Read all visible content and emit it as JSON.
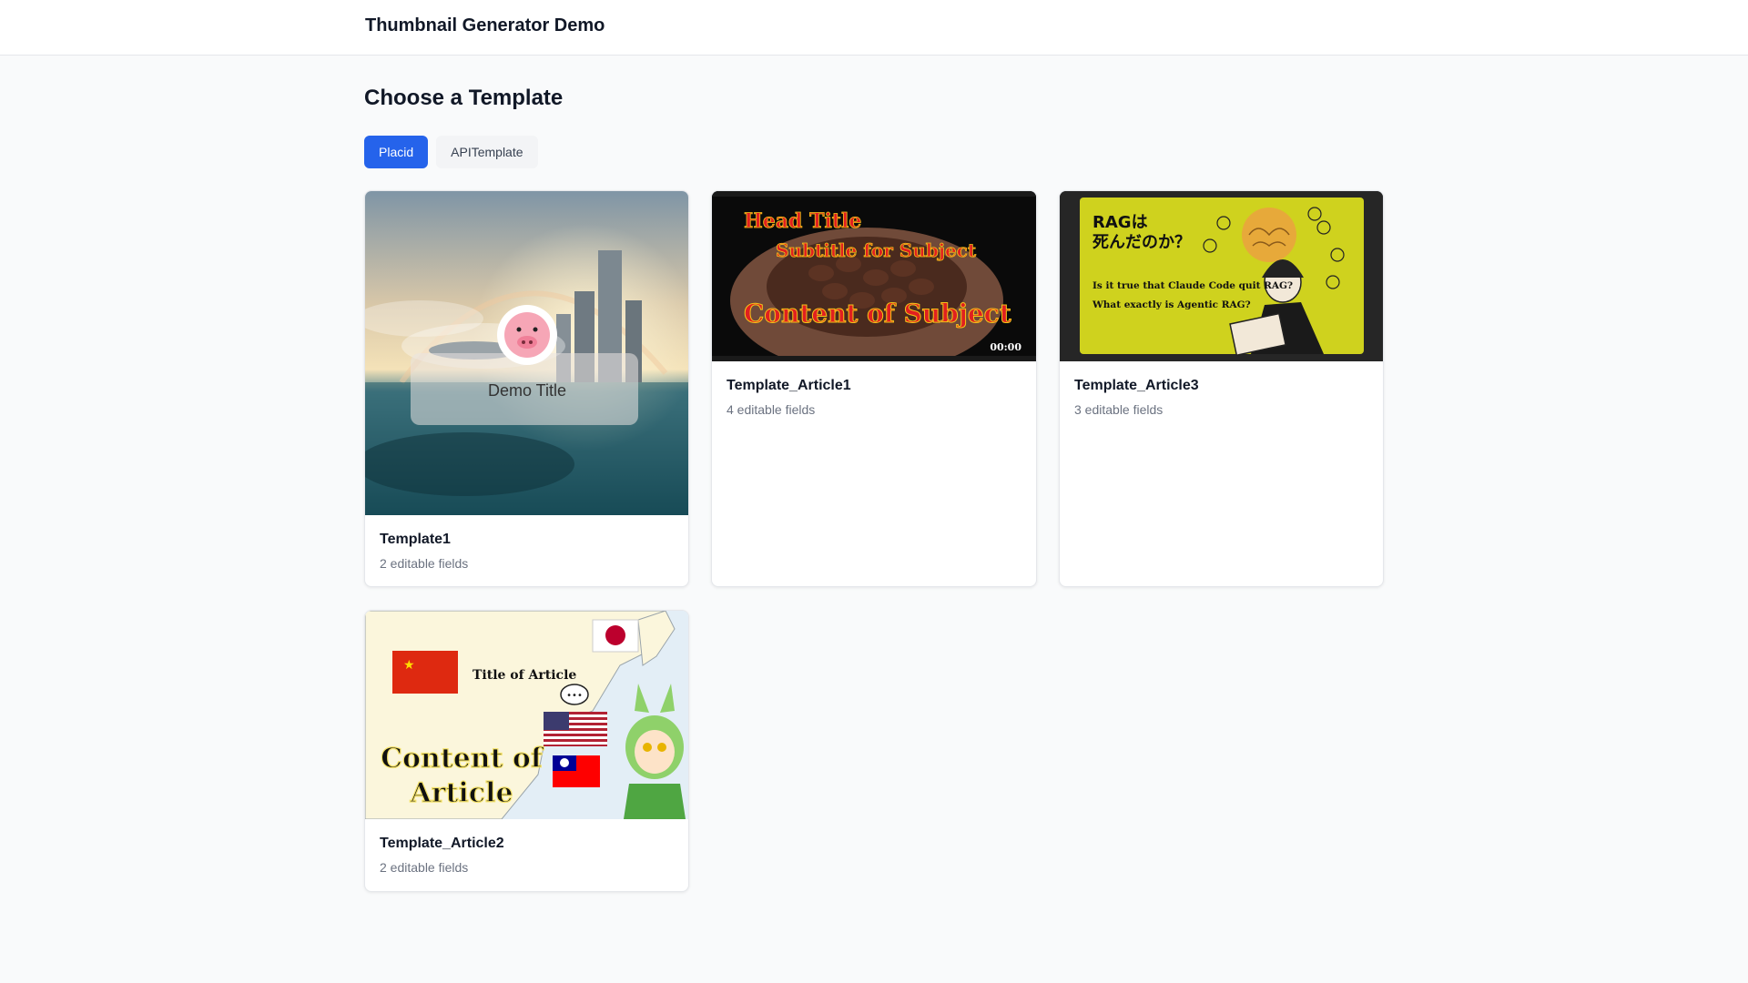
{
  "header": {
    "app_title": "Thumbnail Generator Demo"
  },
  "main": {
    "page_title": "Choose a Template",
    "tabs": [
      {
        "label": "Placid",
        "active": true
      },
      {
        "label": "APITemplate",
        "active": false
      }
    ],
    "templates": [
      {
        "name": "Template1",
        "fields": "2 editable fields",
        "thumb": {
          "title_text": "Demo Title"
        }
      },
      {
        "name": "Template_Article1",
        "fields": "4 editable fields",
        "thumb": {
          "head_title": "Head Title",
          "subtitle": "Subtitle for Subject",
          "content": "Content of Subject",
          "timestamp": "00:00"
        }
      },
      {
        "name": "Template_Article3",
        "fields": "3 editable fields",
        "thumb": {
          "title_line1": "RAGは",
          "title_line2": "死んだのか？",
          "question1": "Is it true that Claude Code quit RAG?",
          "question2": "What exactly is Agentic RAG?"
        }
      },
      {
        "name": "Template_Article2",
        "fields": "2 editable fields",
        "thumb": {
          "title": "Title of Article",
          "content_line1": "Content of",
          "content_line2": "Article"
        }
      }
    ]
  },
  "colors": {
    "accent": "#2563eb",
    "page_bg": "#f9fafb",
    "card_bg": "#ffffff",
    "muted_text": "#6b7280"
  }
}
